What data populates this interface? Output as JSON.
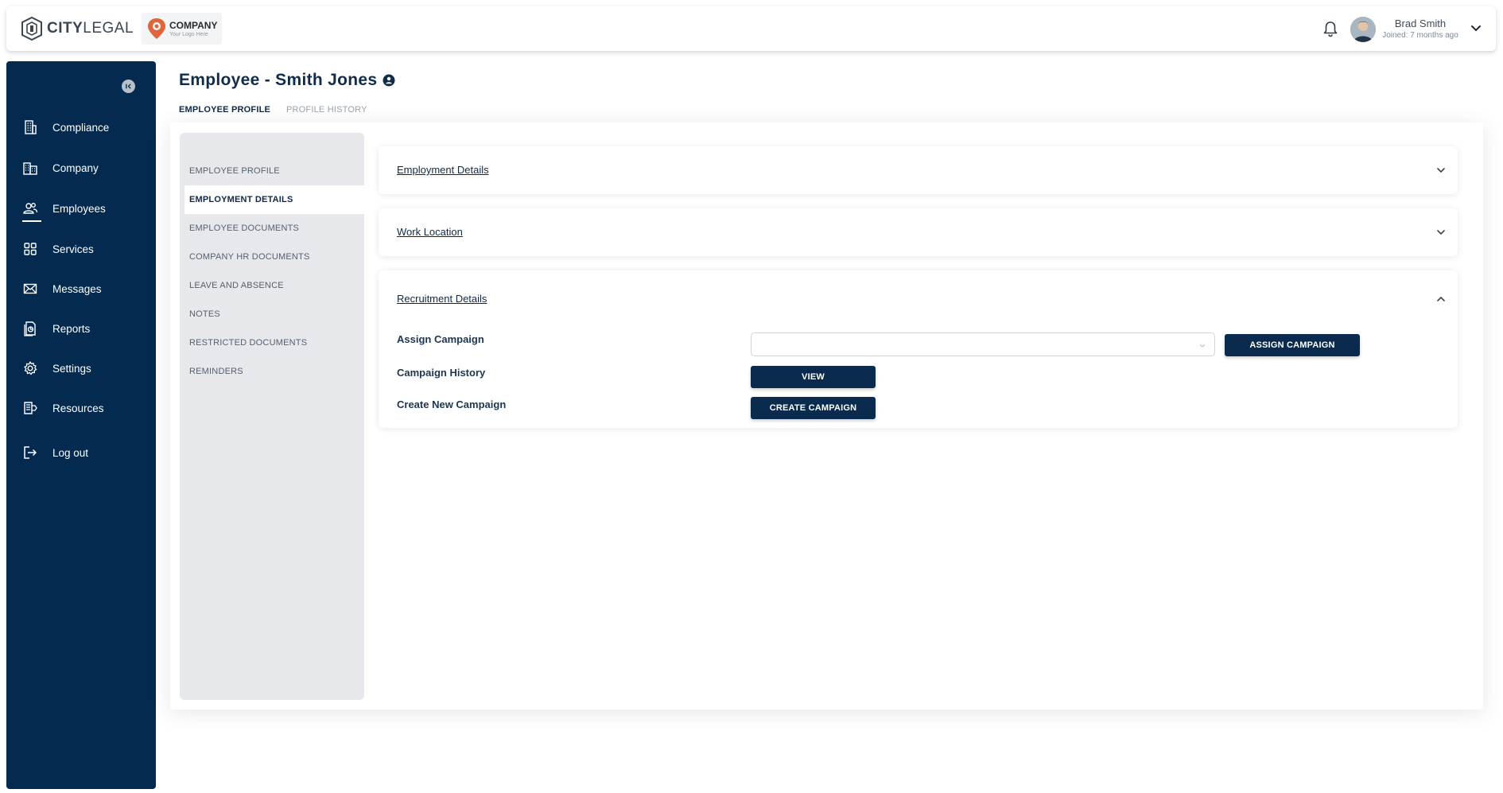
{
  "header": {
    "brand_logo_text_bold": "CITY",
    "brand_logo_text_light": "LEGAL",
    "company_logo_name": "COMPANY",
    "company_logo_sub": "Your Logo Here",
    "user_name": "Brad Smith",
    "user_joined": "Joined: 7 months ago"
  },
  "sidebar": {
    "items": [
      {
        "label": "Compliance",
        "icon": "building-icon"
      },
      {
        "label": "Company",
        "icon": "company-icon"
      },
      {
        "label": "Employees",
        "icon": "users-icon"
      },
      {
        "label": "Services",
        "icon": "grid-icon"
      },
      {
        "label": "Messages",
        "icon": "envelope-icon"
      },
      {
        "label": "Reports",
        "icon": "report-icon"
      },
      {
        "label": "Settings",
        "icon": "gear-icon"
      },
      {
        "label": "Resources",
        "icon": "resources-icon"
      },
      {
        "label": "Log out",
        "icon": "logout-icon"
      }
    ],
    "active": "Employees"
  },
  "page": {
    "title": "Employee - Smith Jones",
    "tabs": [
      {
        "label": "EMPLOYEE PROFILE",
        "active": true
      },
      {
        "label": "PROFILE HISTORY",
        "active": false
      }
    ]
  },
  "subnav": {
    "items": [
      "EMPLOYEE PROFILE",
      "EMPLOYMENT DETAILS",
      "EMPLOYEE DOCUMENTS",
      "COMPANY HR DOCUMENTS",
      "LEAVE AND ABSENCE",
      "NOTES",
      "RESTRICTED DOCUMENTS",
      "REMINDERS"
    ],
    "active": "EMPLOYMENT DETAILS"
  },
  "panels": {
    "employment_details": "Employment Details",
    "work_location": "Work Location",
    "recruitment_details": "Recruitment Details"
  },
  "recruitment": {
    "assign_campaign_label": "Assign Campaign",
    "assign_campaign_value": "",
    "assign_campaign_button": "ASSIGN CAMPAIGN",
    "campaign_history_label": "Campaign History",
    "view_button": "VIEW",
    "create_new_campaign_label": "Create New Campaign",
    "create_campaign_button": "CREATE CAMPAIGN"
  },
  "colors": {
    "sidebar_bg": "#042a4f",
    "button_bg": "#0a2b4e",
    "subnav_bg": "#e6e8ec"
  }
}
